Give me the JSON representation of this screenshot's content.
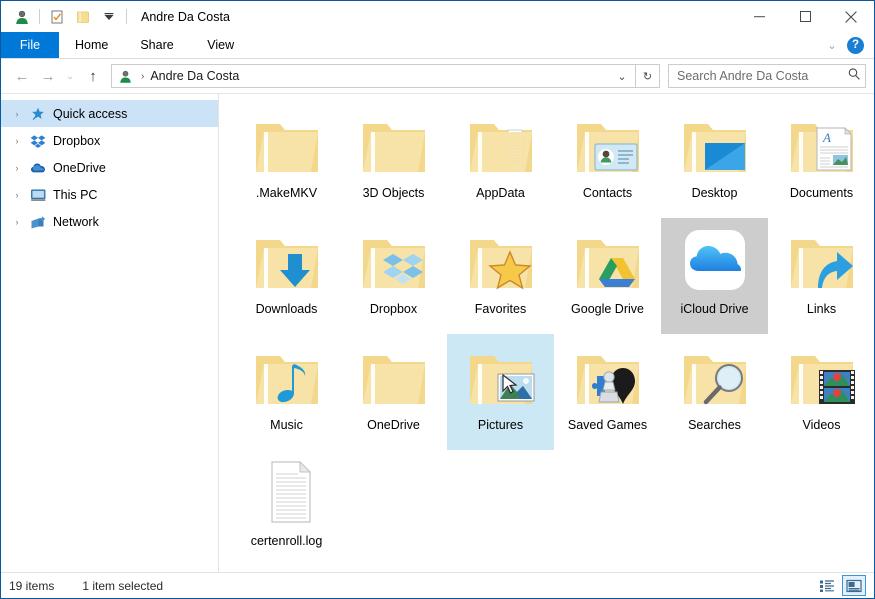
{
  "window": {
    "title": "Andre Da Costa",
    "controls": {
      "minimize": "—",
      "maximize": "□",
      "close": "✕"
    },
    "quick_access_toolbar": [
      {
        "name": "user-folder-icon",
        "label": "Properties"
      },
      {
        "name": "properties-icon",
        "label": "Properties"
      },
      {
        "name": "new-folder-icon",
        "label": "New folder"
      },
      {
        "name": "customize-chevron-icon",
        "label": "Customize Quick Access Toolbar"
      }
    ]
  },
  "ribbon": {
    "tabs": [
      {
        "label": "File",
        "active": true
      },
      {
        "label": "Home",
        "active": false
      },
      {
        "label": "Share",
        "active": false
      },
      {
        "label": "View",
        "active": false
      }
    ],
    "expand_label": "⌄",
    "help_label": "?"
  },
  "address_bar": {
    "back_label": "←",
    "forward_label": "→",
    "recent_label": "⌄",
    "up_label": "↑",
    "breadcrumb_separator": "›",
    "path": "Andre Da Costa",
    "history_label": "⌄",
    "refresh_label": "↻"
  },
  "search": {
    "placeholder": "Search Andre Da Costa",
    "value": ""
  },
  "sidebar": {
    "items": [
      {
        "label": "Quick access",
        "icon": "star-pin-icon",
        "selected": true,
        "chevron": "›"
      },
      {
        "label": "Dropbox",
        "icon": "dropbox-icon",
        "selected": false,
        "chevron": "›"
      },
      {
        "label": "OneDrive",
        "icon": "onedrive-cloud-icon",
        "selected": false,
        "chevron": "›"
      },
      {
        "label": "This PC",
        "icon": "monitor-icon",
        "selected": false,
        "chevron": "›"
      },
      {
        "label": "Network",
        "icon": "network-icon",
        "selected": false,
        "chevron": "›"
      }
    ]
  },
  "files": [
    {
      "name": ".MakeMKV",
      "icon": "folder-plain",
      "state": "normal"
    },
    {
      "name": "3D Objects",
      "icon": "folder-plain",
      "state": "normal"
    },
    {
      "name": "AppData",
      "icon": "folder-appdata",
      "state": "normal"
    },
    {
      "name": "Contacts",
      "icon": "folder-contacts",
      "state": "normal"
    },
    {
      "name": "Desktop",
      "icon": "folder-desktop",
      "state": "normal"
    },
    {
      "name": "Documents",
      "icon": "folder-documents",
      "state": "normal"
    },
    {
      "name": "Downloads",
      "icon": "folder-downloads",
      "state": "normal"
    },
    {
      "name": "Dropbox",
      "icon": "folder-dropbox",
      "state": "normal"
    },
    {
      "name": "Favorites",
      "icon": "folder-favorites",
      "state": "normal"
    },
    {
      "name": "Google Drive",
      "icon": "folder-gdrive",
      "state": "normal"
    },
    {
      "name": "iCloud Drive",
      "icon": "icloud-app",
      "state": "selected"
    },
    {
      "name": "Links",
      "icon": "folder-links",
      "state": "normal"
    },
    {
      "name": "Music",
      "icon": "folder-music",
      "state": "normal"
    },
    {
      "name": "OneDrive",
      "icon": "folder-plain",
      "state": "normal"
    },
    {
      "name": "Pictures",
      "icon": "folder-pictures",
      "state": "hovered"
    },
    {
      "name": "Saved Games",
      "icon": "folder-games",
      "state": "normal"
    },
    {
      "name": "Searches",
      "icon": "folder-searches",
      "state": "normal"
    },
    {
      "name": "Videos",
      "icon": "folder-videos",
      "state": "normal"
    },
    {
      "name": "certenroll.log",
      "icon": "text-file",
      "state": "normal"
    }
  ],
  "status_bar": {
    "item_count": "19 items",
    "selection": "1 item selected",
    "views": [
      {
        "name": "details-view-button",
        "active": false
      },
      {
        "name": "large-icons-view-button",
        "active": true
      }
    ]
  },
  "colors": {
    "accent": "#0078d7",
    "selection_gray": "#cdcdcd",
    "hover_blue": "#cce8f4",
    "nav_selected": "#cce3f7",
    "folder_yellow": "#f5d98b"
  }
}
